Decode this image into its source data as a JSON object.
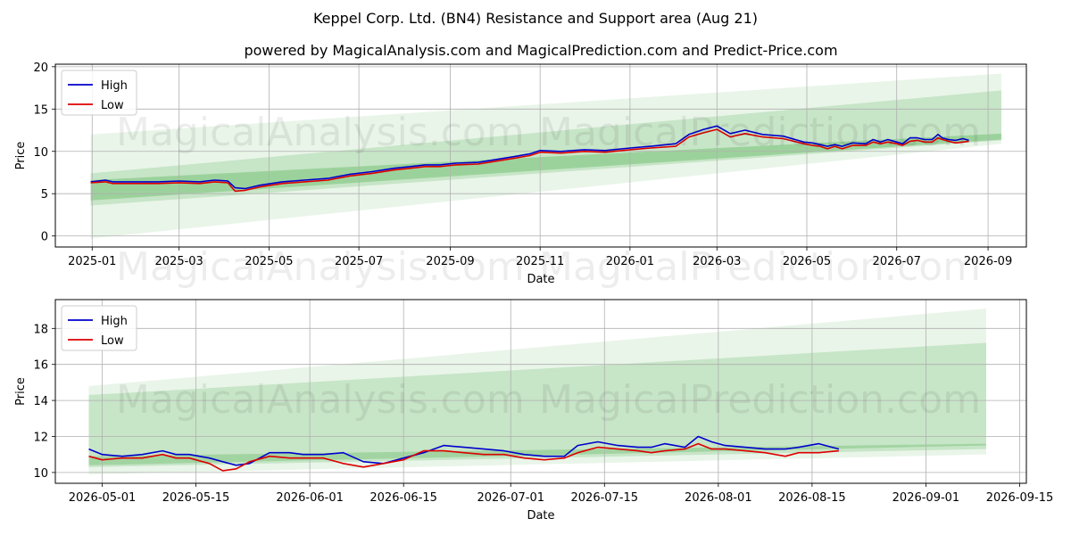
{
  "title": "Keppel Corp. Ltd. (BN4) Resistance and Support area (Aug 21)",
  "subtitle": "powered by MagicalAnalysis.com and MagicalPrediction.com and Predict-Price.com",
  "watermarks": [
    "MagicalAnalysis.com",
    "MagicalPrediction.com"
  ],
  "colors": {
    "high": "#0000cc",
    "low": "#dd0000",
    "band": "#2ca02c",
    "grid": "#b0b0b0"
  },
  "chart_data": [
    {
      "type": "line",
      "xlabel": "Date",
      "ylabel": "Price",
      "xlim": [
        "2024-12-07",
        "2026-09-27"
      ],
      "ylim": [
        -1.3,
        20.3
      ],
      "xticks": [
        "2025-01",
        "2025-03",
        "2025-05",
        "2025-07",
        "2025-09",
        "2025-11",
        "2026-01",
        "2026-03",
        "2026-05",
        "2026-07",
        "2026-09"
      ],
      "yticks": [
        0,
        5,
        10,
        15,
        20
      ],
      "grid": true,
      "legend": "top-left",
      "bands": [
        {
          "x": [
            "2024-12-31",
            "2026-09-10"
          ],
          "lower": [
            -0.3,
            10.9
          ],
          "upper": [
            12.0,
            19.2
          ],
          "opacity": 0.1
        },
        {
          "x": [
            "2024-12-31",
            "2026-09-10"
          ],
          "lower": [
            3.6,
            11.3
          ],
          "upper": [
            7.4,
            17.2
          ],
          "opacity": 0.18
        },
        {
          "x": [
            "2024-12-31",
            "2026-09-10"
          ],
          "lower": [
            4.2,
            11.4
          ],
          "upper": [
            6.6,
            12.1
          ],
          "opacity": 0.28
        }
      ],
      "series": [
        {
          "name": "High",
          "x": [
            "2024-12-31",
            "2025-01-10",
            "2025-01-15",
            "2025-01-20",
            "2025-02-01",
            "2025-02-15",
            "2025-03-01",
            "2025-03-15",
            "2025-03-25",
            "2025-04-03",
            "2025-04-08",
            "2025-04-15",
            "2025-04-25",
            "2025-05-10",
            "2025-05-25",
            "2025-06-10",
            "2025-06-25",
            "2025-07-10",
            "2025-07-25",
            "2025-08-05",
            "2025-08-15",
            "2025-08-25",
            "2025-09-05",
            "2025-09-20",
            "2025-10-01",
            "2025-10-15",
            "2025-10-25",
            "2025-11-01",
            "2025-11-15",
            "2025-12-01",
            "2025-12-15",
            "2026-01-01",
            "2026-01-15",
            "2026-02-01",
            "2026-02-10",
            "2026-02-20",
            "2026-03-01",
            "2026-03-10",
            "2026-03-20",
            "2026-04-01",
            "2026-04-15",
            "2026-04-29",
            "2026-05-05",
            "2026-05-10",
            "2026-05-15",
            "2026-05-20",
            "2026-05-25",
            "2026-06-01",
            "2026-06-10",
            "2026-06-15",
            "2026-06-20",
            "2026-06-25",
            "2026-07-01",
            "2026-07-05",
            "2026-07-10",
            "2026-07-15",
            "2026-07-20",
            "2026-07-25",
            "2026-07-29",
            "2026-08-01",
            "2026-08-05",
            "2026-08-10",
            "2026-08-15",
            "2026-08-19"
          ],
          "values": [
            6.4,
            6.6,
            6.4,
            6.4,
            6.4,
            6.4,
            6.5,
            6.4,
            6.6,
            6.5,
            5.7,
            5.6,
            6.0,
            6.4,
            6.6,
            6.8,
            7.3,
            7.6,
            8.0,
            8.2,
            8.4,
            8.4,
            8.6,
            8.7,
            9.0,
            9.4,
            9.7,
            10.1,
            10.0,
            10.2,
            10.1,
            10.4,
            10.6,
            10.9,
            12.0,
            12.6,
            13.0,
            12.1,
            12.5,
            12.0,
            11.8,
            11.1,
            11.0,
            10.8,
            10.6,
            10.8,
            10.6,
            11.0,
            10.9,
            11.4,
            11.1,
            11.4,
            11.1,
            10.9,
            11.6,
            11.6,
            11.4,
            11.4,
            12.0,
            11.6,
            11.4,
            11.3,
            11.5,
            11.3
          ]
        },
        {
          "name": "Low",
          "x": [
            "2024-12-31",
            "2025-01-10",
            "2025-01-15",
            "2025-01-20",
            "2025-02-01",
            "2025-02-15",
            "2025-03-01",
            "2025-03-15",
            "2025-03-25",
            "2025-04-03",
            "2025-04-08",
            "2025-04-15",
            "2025-04-25",
            "2025-05-10",
            "2025-05-25",
            "2025-06-10",
            "2025-06-25",
            "2025-07-10",
            "2025-07-25",
            "2025-08-05",
            "2025-08-15",
            "2025-08-25",
            "2025-09-05",
            "2025-09-20",
            "2025-10-01",
            "2025-10-15",
            "2025-10-25",
            "2025-11-01",
            "2025-11-15",
            "2025-12-01",
            "2025-12-15",
            "2026-01-01",
            "2026-01-15",
            "2026-02-01",
            "2026-02-10",
            "2026-02-20",
            "2026-03-01",
            "2026-03-10",
            "2026-03-20",
            "2026-04-01",
            "2026-04-15",
            "2026-04-29",
            "2026-05-05",
            "2026-05-10",
            "2026-05-15",
            "2026-05-20",
            "2026-05-25",
            "2026-06-01",
            "2026-06-10",
            "2026-06-15",
            "2026-06-20",
            "2026-06-25",
            "2026-07-01",
            "2026-07-05",
            "2026-07-10",
            "2026-07-15",
            "2026-07-20",
            "2026-07-25",
            "2026-07-29",
            "2026-08-01",
            "2026-08-05",
            "2026-08-10",
            "2026-08-15",
            "2026-08-19"
          ],
          "values": [
            6.3,
            6.4,
            6.2,
            6.2,
            6.2,
            6.2,
            6.3,
            6.2,
            6.4,
            6.3,
            5.3,
            5.4,
            5.8,
            6.2,
            6.4,
            6.6,
            7.1,
            7.4,
            7.8,
            8.0,
            8.2,
            8.2,
            8.4,
            8.5,
            8.8,
            9.2,
            9.5,
            9.9,
            9.8,
            10.0,
            9.9,
            10.2,
            10.4,
            10.6,
            11.7,
            12.2,
            12.6,
            11.7,
            12.1,
            11.7,
            11.5,
            10.9,
            10.7,
            10.6,
            10.3,
            10.6,
            10.3,
            10.7,
            10.7,
            11.1,
            10.9,
            11.1,
            10.9,
            10.7,
            11.2,
            11.3,
            11.1,
            11.1,
            11.6,
            11.4,
            11.2,
            11.0,
            11.1,
            11.2
          ]
        }
      ]
    },
    {
      "type": "line",
      "xlabel": "Date",
      "ylabel": "Price",
      "xlim": [
        "2026-04-24",
        "2026-09-16"
      ],
      "ylim": [
        9.4,
        19.6
      ],
      "xticks": [
        "2026-05-01",
        "2026-05-15",
        "2026-06-01",
        "2026-06-15",
        "2026-07-01",
        "2026-07-15",
        "2026-08-01",
        "2026-08-15",
        "2026-09-01",
        "2026-09-15"
      ],
      "yticks": [
        10,
        12,
        14,
        16,
        18
      ],
      "grid": true,
      "legend": "top-left",
      "bands": [
        {
          "x": [
            "2026-04-29",
            "2026-09-10"
          ],
          "lower": [
            9.9,
            11.0
          ],
          "upper": [
            14.8,
            19.1
          ],
          "opacity": 0.1
        },
        {
          "x": [
            "2026-04-29",
            "2026-09-10"
          ],
          "lower": [
            10.3,
            11.3
          ],
          "upper": [
            14.3,
            17.2
          ],
          "opacity": 0.18
        },
        {
          "x": [
            "2026-04-29",
            "2026-09-10"
          ],
          "lower": [
            10.4,
            11.5
          ],
          "upper": [
            10.9,
            11.6
          ],
          "opacity": 0.24
        }
      ],
      "series": [
        {
          "name": "High",
          "x": [
            "2026-04-29",
            "2026-05-01",
            "2026-05-04",
            "2026-05-07",
            "2026-05-10",
            "2026-05-12",
            "2026-05-14",
            "2026-05-17",
            "2026-05-19",
            "2026-05-21",
            "2026-05-23",
            "2026-05-26",
            "2026-05-29",
            "2026-05-31",
            "2026-06-03",
            "2026-06-06",
            "2026-06-09",
            "2026-06-12",
            "2026-06-15",
            "2026-06-18",
            "2026-06-21",
            "2026-06-24",
            "2026-06-27",
            "2026-06-30",
            "2026-07-03",
            "2026-07-06",
            "2026-07-09",
            "2026-07-11",
            "2026-07-14",
            "2026-07-17",
            "2026-07-20",
            "2026-07-22",
            "2026-07-24",
            "2026-07-27",
            "2026-07-29",
            "2026-07-31",
            "2026-08-02",
            "2026-08-05",
            "2026-08-08",
            "2026-08-11",
            "2026-08-13",
            "2026-08-16",
            "2026-08-19"
          ],
          "values": [
            11.3,
            11.0,
            10.9,
            11.0,
            11.2,
            11.0,
            11.0,
            10.8,
            10.6,
            10.4,
            10.5,
            11.1,
            11.1,
            11.0,
            11.0,
            11.1,
            10.6,
            10.5,
            10.8,
            11.1,
            11.5,
            11.4,
            11.3,
            11.2,
            11.0,
            10.9,
            10.9,
            11.5,
            11.7,
            11.5,
            11.4,
            11.4,
            11.6,
            11.4,
            12.0,
            11.7,
            11.5,
            11.4,
            11.3,
            11.3,
            11.4,
            11.6,
            11.3
          ]
        },
        {
          "name": "Low",
          "x": [
            "2026-04-29",
            "2026-05-01",
            "2026-05-04",
            "2026-05-07",
            "2026-05-10",
            "2026-05-12",
            "2026-05-14",
            "2026-05-17",
            "2026-05-19",
            "2026-05-21",
            "2026-05-23",
            "2026-05-26",
            "2026-05-29",
            "2026-05-31",
            "2026-06-03",
            "2026-06-06",
            "2026-06-09",
            "2026-06-12",
            "2026-06-15",
            "2026-06-18",
            "2026-06-21",
            "2026-06-24",
            "2026-06-27",
            "2026-06-30",
            "2026-07-03",
            "2026-07-06",
            "2026-07-09",
            "2026-07-11",
            "2026-07-14",
            "2026-07-17",
            "2026-07-20",
            "2026-07-22",
            "2026-07-24",
            "2026-07-27",
            "2026-07-29",
            "2026-07-31",
            "2026-08-02",
            "2026-08-05",
            "2026-08-08",
            "2026-08-11",
            "2026-08-13",
            "2026-08-16",
            "2026-08-19"
          ],
          "values": [
            10.9,
            10.7,
            10.8,
            10.8,
            11.0,
            10.8,
            10.8,
            10.5,
            10.1,
            10.2,
            10.6,
            10.9,
            10.8,
            10.8,
            10.8,
            10.5,
            10.3,
            10.5,
            10.7,
            11.2,
            11.2,
            11.1,
            11.0,
            11.0,
            10.8,
            10.7,
            10.8,
            11.1,
            11.4,
            11.3,
            11.2,
            11.1,
            11.2,
            11.3,
            11.6,
            11.3,
            11.3,
            11.2,
            11.1,
            10.9,
            11.1,
            11.1,
            11.2
          ]
        }
      ]
    }
  ]
}
